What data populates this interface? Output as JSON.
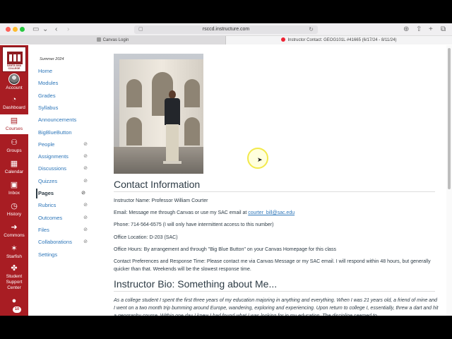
{
  "browser": {
    "url": "rsccd.instructure.com",
    "tabs": [
      {
        "label": "Canvas Login"
      },
      {
        "label": "Instructor Contact: GEOG101L #41665 (6/17/24 - 8/11/24)"
      }
    ]
  },
  "global_nav": {
    "logo_text": "SANTA ANA COLLEGE",
    "items": [
      {
        "label": "Account",
        "icon": "avatar-icon"
      },
      {
        "label": "Dashboard",
        "icon": "dashboard-icon"
      },
      {
        "label": "Courses",
        "icon": "courses-icon"
      },
      {
        "label": "Groups",
        "icon": "groups-icon"
      },
      {
        "label": "Calendar",
        "icon": "calendar-icon"
      },
      {
        "label": "Inbox",
        "icon": "inbox-icon"
      },
      {
        "label": "History",
        "icon": "history-icon"
      },
      {
        "label": "Commons",
        "icon": "commons-icon"
      },
      {
        "label": "Starfish",
        "icon": "starfish-icon"
      },
      {
        "label": "Student Support Center",
        "icon": "support-icon"
      }
    ],
    "badge": "10"
  },
  "course_nav": {
    "term": "Summer 2024",
    "items": [
      {
        "label": "Home",
        "hidden": false
      },
      {
        "label": "Modules",
        "hidden": false
      },
      {
        "label": "Grades",
        "hidden": false
      },
      {
        "label": "Syllabus",
        "hidden": false
      },
      {
        "label": "Announcements",
        "hidden": false
      },
      {
        "label": "BigBlueButton",
        "hidden": false
      },
      {
        "label": "People",
        "hidden": true
      },
      {
        "label": "Assignments",
        "hidden": true
      },
      {
        "label": "Discussions",
        "hidden": true
      },
      {
        "label": "Quizzes",
        "hidden": true
      },
      {
        "label": "Pages",
        "hidden": true,
        "active": true
      },
      {
        "label": "Rubrics",
        "hidden": true
      },
      {
        "label": "Outcomes",
        "hidden": true
      },
      {
        "label": "Files",
        "hidden": true
      },
      {
        "label": "Collaborations",
        "hidden": true
      },
      {
        "label": "Settings",
        "hidden": false
      }
    ]
  },
  "content": {
    "contact_heading": "Contact Information",
    "instructor_name": "Instructor Name: Professor William Courter",
    "email_prefix": "Email: Message me through Canvas or use my SAC email at ",
    "email_link": "courter_bill@sac.edu",
    "phone": "Phone: 714-564-6575 (I will only have intermittent access to this number)",
    "office_location": "Office Location: D-203 (SAC)",
    "office_hours": "Office Hours: By arrangement and through \"Big Blue Button\" on your Canvas Homepage for this class",
    "response_time": "Contact Preferences and Response Time: Please contact me via Canvas Message or my SAC email. I will respond within 48 hours, but generally quicker than that. Weekends will be the slowest response time.",
    "bio_heading": "Instructor Bio: Something about Me...",
    "bio_text": "As a college student I spent the first three years of my education majoring in anything and everything. When I was 21 years old, a friend of mine and I went on a two month trip bumming around Europe, wandering, exploring and experiencing. Upon return to college I, essentially, threw a dart and hit a geography course. Within one day I knew I had found what I was looking for in my education. The discipline seemed to"
  },
  "colors": {
    "global_nav_bg": "#a81d23",
    "link": "#2d76b9",
    "text": "#2d3b45"
  }
}
